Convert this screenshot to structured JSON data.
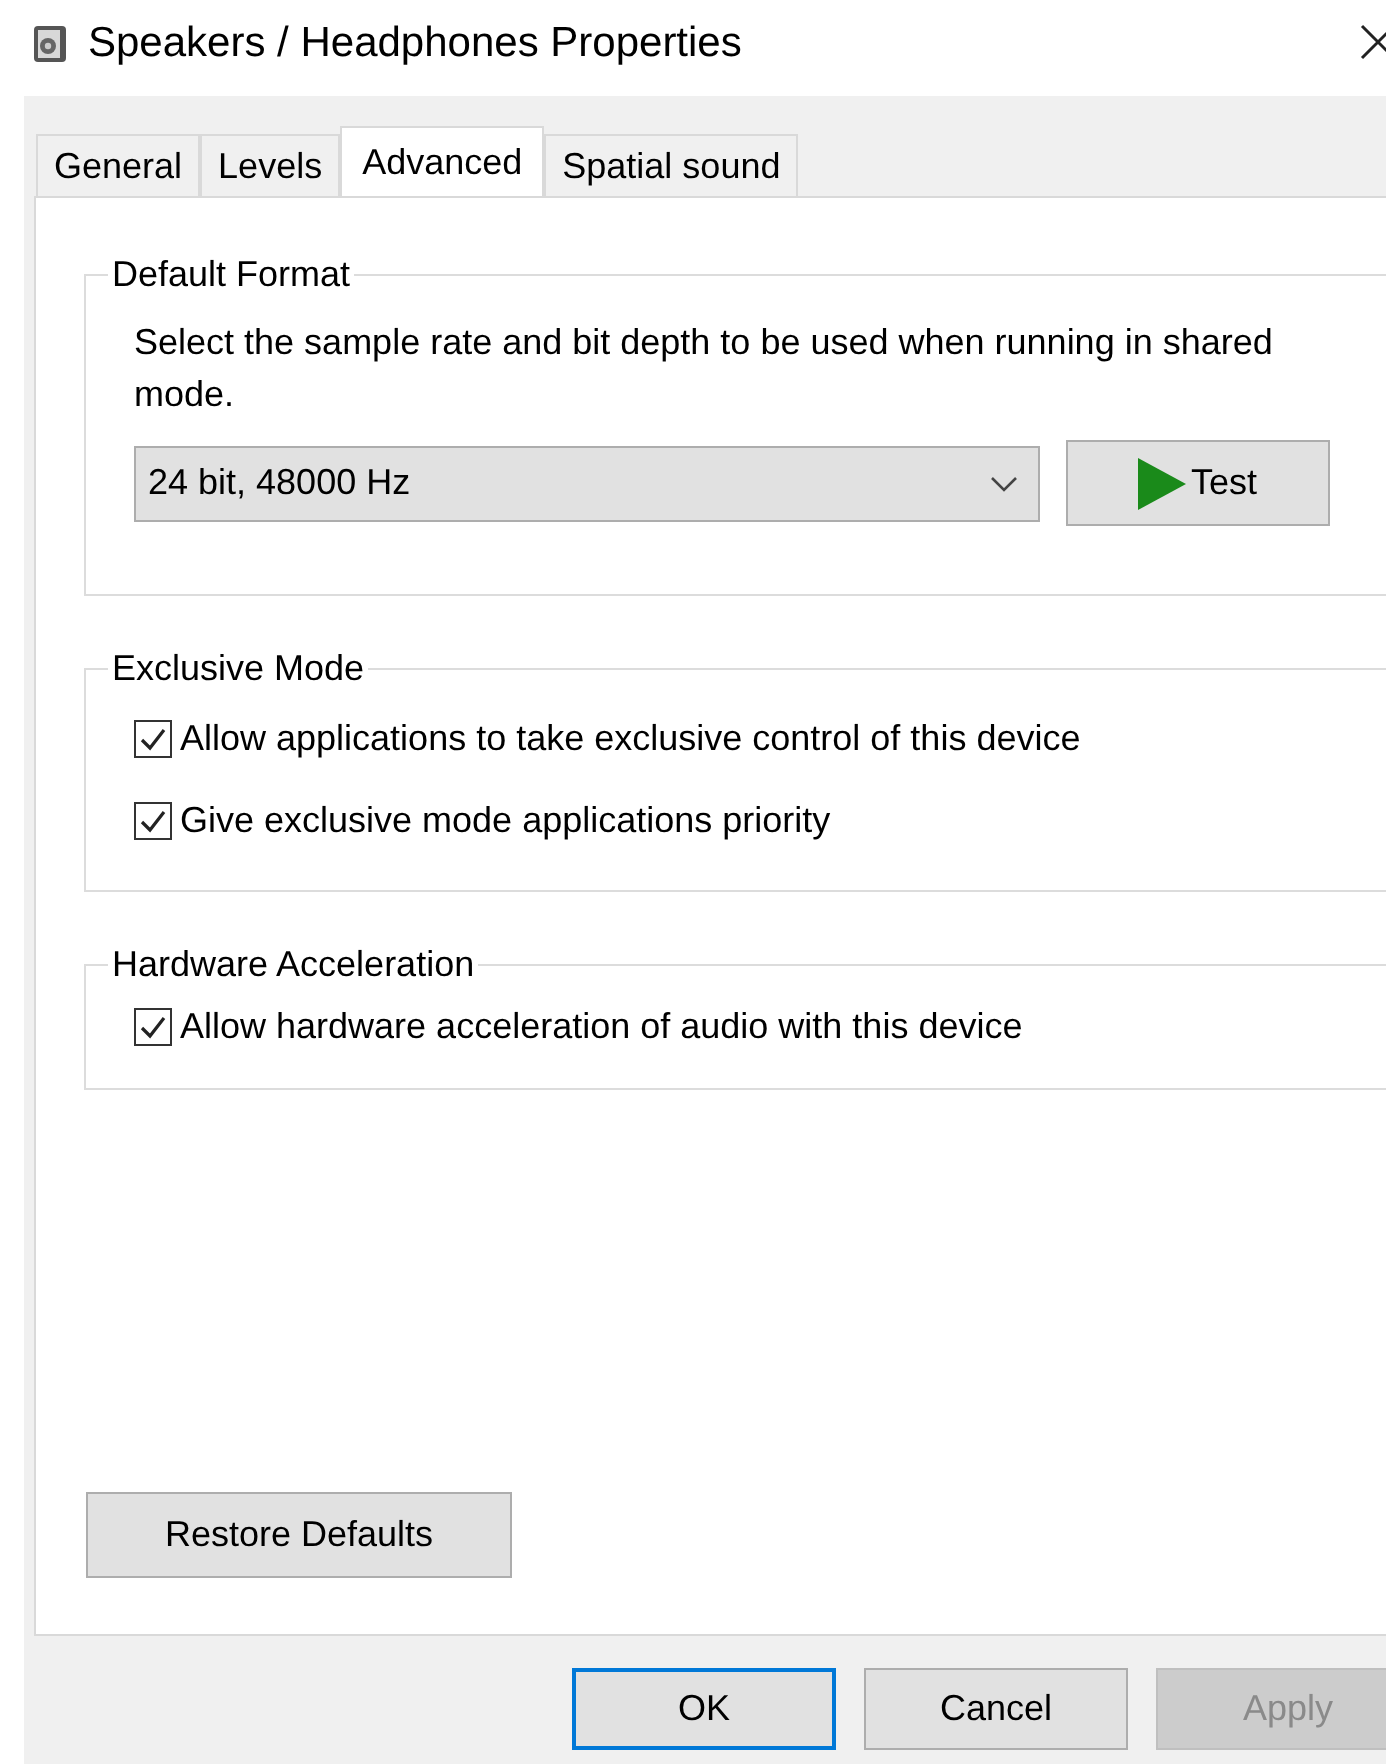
{
  "window": {
    "title": "Speakers / Headphones Properties"
  },
  "tabs": [
    {
      "label": "General",
      "selected": false
    },
    {
      "label": "Levels",
      "selected": false
    },
    {
      "label": "Advanced",
      "selected": true
    },
    {
      "label": "Spatial sound",
      "selected": false
    }
  ],
  "groups": [
    {
      "kind": "format",
      "title": "Default Format",
      "description": "Select the sample rate and bit depth to be used when running in shared mode.",
      "format": "24 bit, 48000 Hz",
      "test_button": "Test"
    },
    {
      "kind": "checks",
      "title": "Exclusive Mode",
      "checkboxes": [
        {
          "label": "Allow applications to take exclusive control of this device",
          "checked": true
        },
        {
          "label": "Give exclusive mode applications priority",
          "checked": true
        }
      ]
    },
    {
      "kind": "checks",
      "title": "Hardware Acceleration",
      "checkboxes": [
        {
          "label": "Allow hardware acceleration of audio with this device",
          "checked": true
        }
      ]
    }
  ],
  "restore_button": "Restore Defaults",
  "buttons": [
    {
      "label": "OK",
      "default": true,
      "disabled": false
    },
    {
      "label": "Cancel",
      "default": false,
      "disabled": false
    },
    {
      "label": "Apply",
      "default": false,
      "disabled": true
    }
  ]
}
